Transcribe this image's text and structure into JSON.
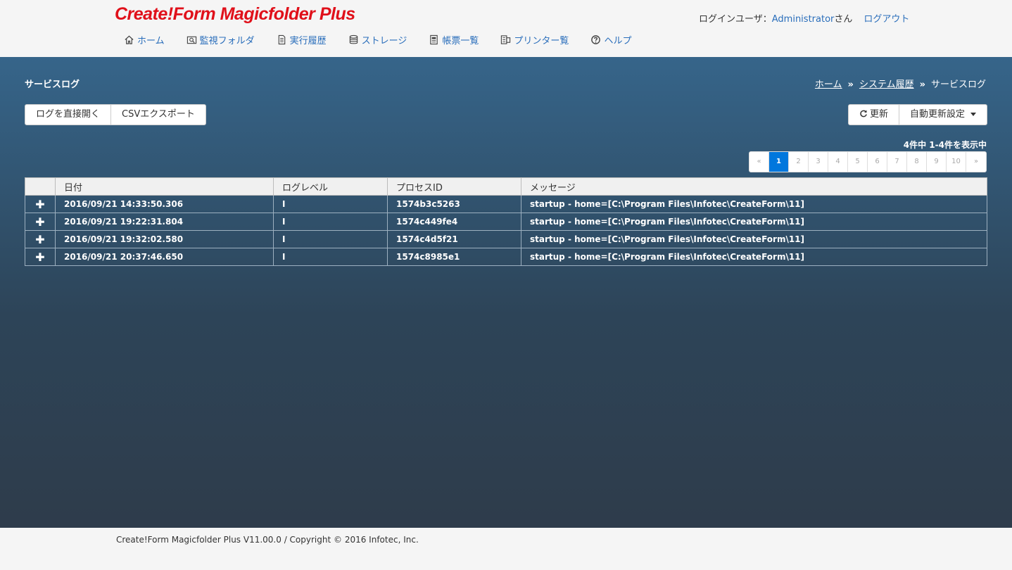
{
  "header": {
    "logo": "Create!Form Magicfolder Plus",
    "login_label": "ログインユーザ：",
    "username": "Administrator",
    "honorific": "さん",
    "logout": "ログアウト"
  },
  "nav": [
    {
      "label": "ホーム",
      "icon": "home-icon"
    },
    {
      "label": "監視フォルダ",
      "icon": "folder-search-icon"
    },
    {
      "label": "実行履歴",
      "icon": "document-icon"
    },
    {
      "label": "ストレージ",
      "icon": "database-icon"
    },
    {
      "label": "帳票一覧",
      "icon": "report-list-icon"
    },
    {
      "label": "プリンター覧",
      "icon": "printer-icon"
    },
    {
      "label": "ヘルプ",
      "icon": "help-icon"
    }
  ],
  "page": {
    "title": "サービスログ",
    "breadcrumb": {
      "home": "ホーム",
      "sep": "»",
      "system_history": "システム履歴",
      "current": "サービスログ"
    }
  },
  "toolbar": {
    "open_log": "ログを直接開く",
    "csv_export": "CSVエクスポート",
    "refresh": "更新",
    "auto_refresh": "自動更新設定"
  },
  "results": {
    "count_text": "4件中 1-4件を表示中"
  },
  "pagination": {
    "prev": "«",
    "pages": [
      "1",
      "2",
      "3",
      "4",
      "5",
      "6",
      "7",
      "8",
      "9",
      "10"
    ],
    "active": "1",
    "next": "»"
  },
  "table": {
    "headers": [
      "",
      "日付",
      "ログレベル",
      "プロセスID",
      "メッセージ"
    ],
    "expand_symbol": "✚",
    "rows": [
      {
        "date": "2016/09/21 14:33:50.306",
        "level": "I",
        "pid": "1574b3c5263",
        "message": "startup - home=[C:\\Program Files\\Infotec\\CreateForm\\11]"
      },
      {
        "date": "2016/09/21 19:22:31.804",
        "level": "I",
        "pid": "1574c449fe4",
        "message": "startup - home=[C:\\Program Files\\Infotec\\CreateForm\\11]"
      },
      {
        "date": "2016/09/21 19:32:02.580",
        "level": "I",
        "pid": "1574c4d5f21",
        "message": "startup - home=[C:\\Program Files\\Infotec\\CreateForm\\11]"
      },
      {
        "date": "2016/09/21 20:37:46.650",
        "level": "I",
        "pid": "1574c8985e1",
        "message": "startup - home=[C:\\Program Files\\Infotec\\CreateForm\\11]"
      }
    ]
  },
  "footer": {
    "text": "Create!Form Magicfolder Plus V11.00.0 / Copyright © 2016 Infotec, Inc."
  },
  "colors": {
    "logo": "#e0101a",
    "link": "#2a6ebb",
    "active_page": "#0077dd",
    "main_bg_top": "#36658a",
    "main_bg_bottom": "#2e3c4b"
  }
}
